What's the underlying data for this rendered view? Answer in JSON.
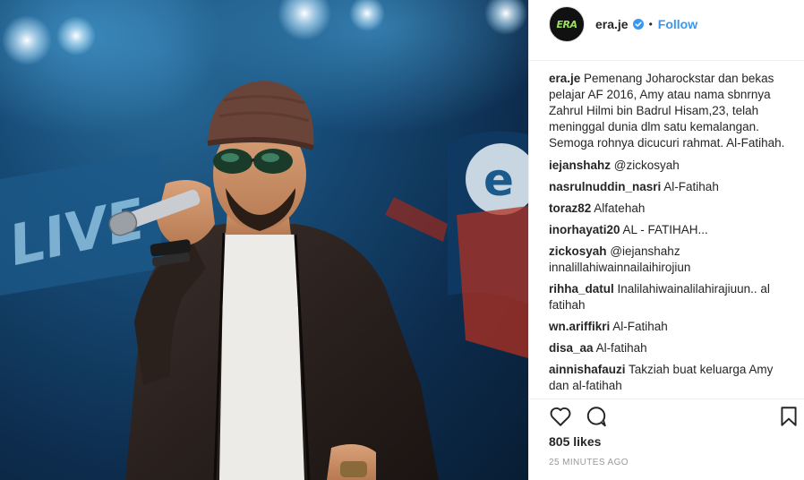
{
  "post": {
    "username": "era.je",
    "separator": "•",
    "follow_label": "Follow",
    "avatar_text": "ERA",
    "caption": {
      "user": "era.je",
      "text": "Pemenang Joharockstar dan bekas pelajar AF 2016, Amy atau nama sbnrnya Zahrul Hilmi bin Badrul Hisam,23, telah meninggal dunia dlm satu kemalangan. Semoga rohnya dicucuri rahmat. Al-Fatihah."
    },
    "comments": [
      {
        "user": "iejanshahz",
        "text": "@zickosyah"
      },
      {
        "user": "nasrulnuddin_nasri",
        "text": "Al-Fatihah"
      },
      {
        "user": "toraz82",
        "text": "Alfatehah"
      },
      {
        "user": "inorhayati20",
        "text": "AL - FATIHAH..."
      },
      {
        "user": "zickosyah",
        "text": "@iejanshahz innalillahiwainnailaihirojiun"
      },
      {
        "user": "rihha_datul",
        "text": "Inalilahiwainalilahirajiuun.. al fatihah"
      },
      {
        "user": "wn.ariffikri",
        "text": "Al-Fatihah"
      },
      {
        "user": "disa_aa",
        "text": "Al-fatihah"
      },
      {
        "user": "ainnishafauzi",
        "text": "Takziah buat keluarga Amy dan al-fatihah"
      }
    ],
    "likes": "805 likes",
    "timestamp": "25 MINUTES AGO",
    "icons": {
      "verified": "verified-badge-icon",
      "like": "heart-icon",
      "comment": "comment-bubble-icon",
      "save": "bookmark-icon"
    },
    "colors": {
      "follow": "#3897f0",
      "verified": "#3897f0",
      "timestamp": "#999999"
    }
  }
}
